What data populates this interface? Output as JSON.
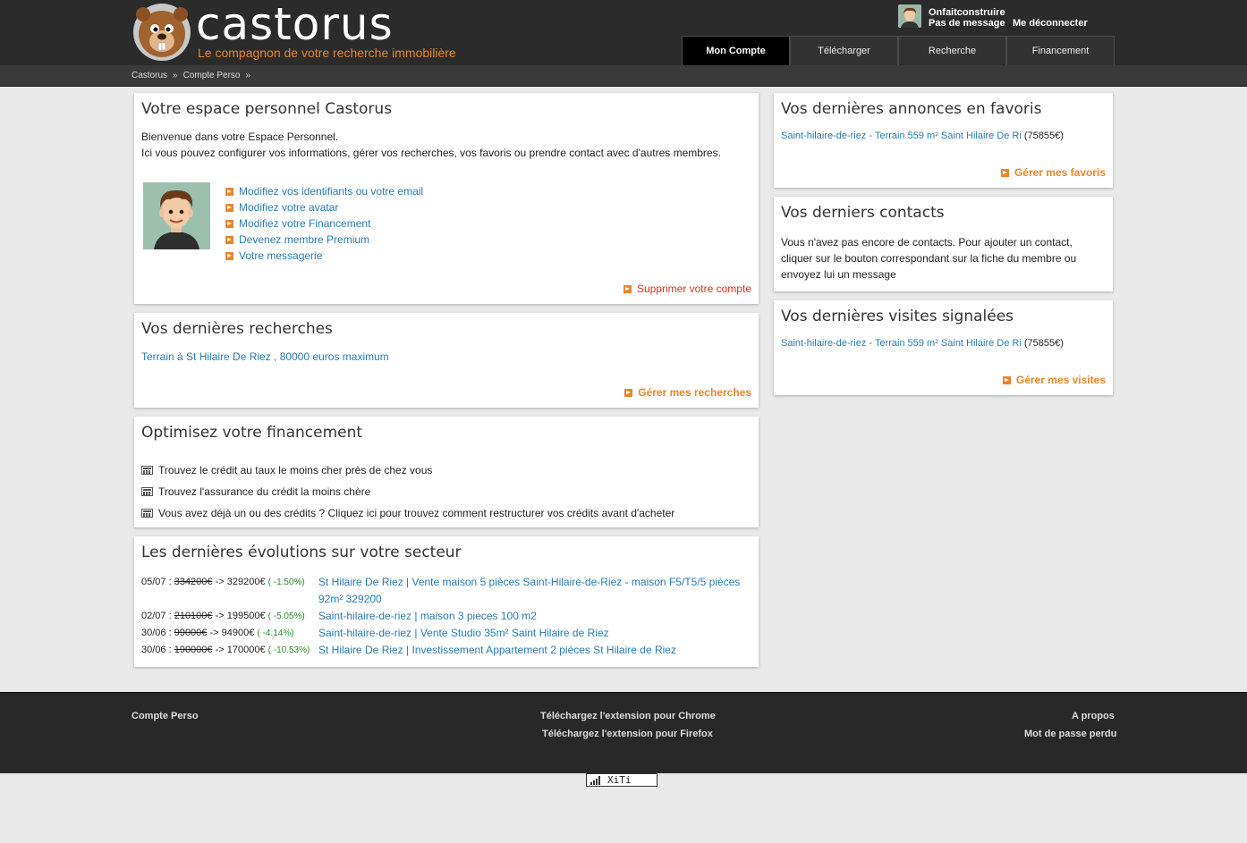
{
  "header": {
    "brand": "castorus",
    "tagline": "Le compagnon de votre recherche immobilière",
    "user_name": "Onfaitconstruire",
    "message_status": "Pas de message",
    "logout": "Me déconnecter",
    "tabs": [
      {
        "label": "Mon Compte",
        "active": true
      },
      {
        "label": "Télécharger",
        "active": false
      },
      {
        "label": "Recherche",
        "active": false
      },
      {
        "label": "Financement",
        "active": false
      }
    ]
  },
  "breadcrumb": [
    "Castorus",
    "»",
    "Compte Perso",
    "»"
  ],
  "espace": {
    "title": "Votre espace personnel Castorus",
    "intro_line1": "Bienvenue dans votre Espace Personnel.",
    "intro_line2": "Ici vous pouvez configurer vos informations, gérer vos recherches, vos favoris ou prendre contact avec d'autres membres.",
    "links": [
      "Modifiez vos identifiants ou votre email",
      "Modifiez votre avatar",
      "Modifiez votre Financement",
      "Devenez membre Premium",
      "Votre messagerie"
    ],
    "delete": "Supprimer votre compte"
  },
  "recherches": {
    "title": "Vos dernières recherches",
    "item": "Terrain à St Hilaire De Riez , 80000 euros maximum",
    "manage": "Gérer mes recherches"
  },
  "financement": {
    "title": "Optimisez votre financement",
    "items": [
      "Trouvez le crédit au taux le moins cher près de chez vous",
      "Trouvez l'assurance du crédit la moins chère",
      "Vous avez déjà un ou des crédits ? Cliquez ici pour trouvez comment restructurer vos crédits avant d'acheter"
    ]
  },
  "evolutions": {
    "title": "Les dernières évolutions sur votre secteur",
    "rows": [
      {
        "date": "05/07 :",
        "old": "334200€",
        "arrow": "->",
        "new": "329200€",
        "pct": "( -1.50%)",
        "link": "St Hilaire De Riez | Vente maison 5 pièces Saint-Hilaire-de-Riez - maison F5/T5/5 pièces 92m² 329200"
      },
      {
        "date": "02/07 :",
        "old": "210100€",
        "arrow": "->",
        "new": "199500€",
        "pct": "( -5.05%)",
        "link": "Saint-hilaire-de-riez | maison 3 pieces 100 m2"
      },
      {
        "date": "30/06 :",
        "old": "99000€",
        "arrow": "->",
        "new": "94900€",
        "pct": "( -4.14%)",
        "link": "Saint-hilaire-de-riez | Vente Studio 35m² Saint Hilaire de Riez"
      },
      {
        "date": "30/06 :",
        "old": "190000€",
        "arrow": "->",
        "new": "170000€",
        "pct": "( -10.53%)",
        "link": "St Hilaire De Riez | Investissement Appartement 2 pièces St Hilaire de Riez"
      }
    ]
  },
  "favoris": {
    "title": "Vos dernières annonces en favoris",
    "link": "Saint-hilaire-de-riez - Terrain 559 m² Saint Hilaire De Ri",
    "price": "(75855€)",
    "manage": "Gérer mes favoris"
  },
  "contacts": {
    "title": "Vos derniers contacts",
    "text": "Vous n'avez pas encore de contacts. Pour ajouter un contact, cliquer sur le bouton correspondant sur la fiche du membre ou envoyez lui un message"
  },
  "visites": {
    "title": "Vos dernières visites signalées",
    "link": "Saint-hilaire-de-riez - Terrain 559 m² Saint Hilaire De Ri",
    "price": "(75855€)",
    "manage": "Gérer mes visites"
  },
  "footer": {
    "compte": "Compte Perso",
    "chrome": "Téléchargez l'extension pour Chrome",
    "firefox": "Téléchargez l'extension pour Firefox",
    "apropos": "A propos",
    "password": "Mot de passe perdu",
    "xiti": "XiTi"
  },
  "colors": {
    "accent": "#e8862b",
    "link": "#2a7ab0",
    "header": "#2b2b2b",
    "danger": "#d0351c"
  }
}
